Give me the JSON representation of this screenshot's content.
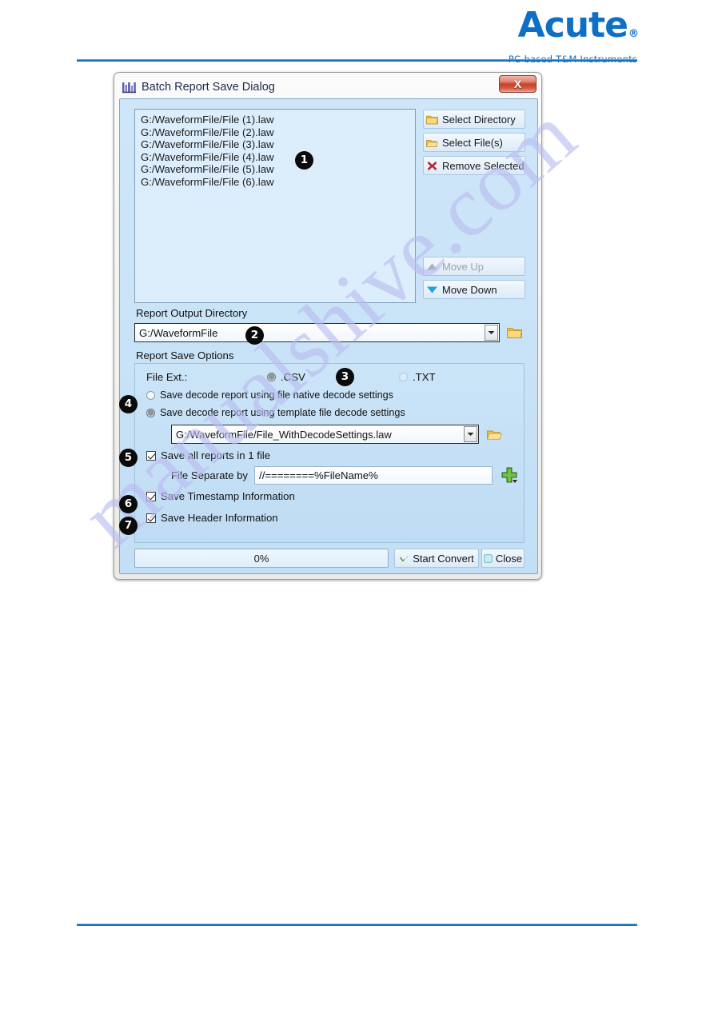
{
  "header": {
    "logo_name": "Acute",
    "logo_registered": "®",
    "logo_tagline": "PC-based T&M Instruments",
    "brand_color": "#0F6FC5"
  },
  "watermark": {
    "text": "manualshive.com"
  },
  "dialog": {
    "title": "Batch Report Save Dialog",
    "title_icon": "waveform-icon",
    "close_label": "X",
    "file_list": {
      "items": [
        "G:/WaveformFile/File (1).law",
        "G:/WaveformFile/File (2).law",
        "G:/WaveformFile/File (3).law",
        "G:/WaveformFile/File (4).law",
        "G:/WaveformFile/File (5).law",
        "G:/WaveformFile/File (6).law"
      ]
    },
    "side_buttons": {
      "select_directory": "Select Directory",
      "select_files": "Select File(s)",
      "remove_selected": "Remove Selected",
      "move_up": "Move Up",
      "move_down": "Move Down"
    },
    "output_directory": {
      "label": "Report Output Directory",
      "value": "G:/WaveformFile",
      "browse_icon": "folder-open-icon"
    },
    "save_options": {
      "label": "Report Save Options",
      "file_ext_label": "File Ext.:",
      "file_ext_options": [
        {
          "label": ".CSV",
          "selected": true
        },
        {
          "label": ".TXT",
          "selected": false
        }
      ],
      "decode_mode_options": [
        {
          "label": "Save decode report using file native decode settings",
          "selected": false
        },
        {
          "label": "Save decode report using template file decode settings",
          "selected": true
        }
      ],
      "template_file": {
        "value": "G:/WaveformFile/File_WithDecodeSettings.law",
        "browse_icon": "folder-open-icon"
      },
      "save_all_in_one": {
        "label": "Save all reports in 1 file",
        "checked": true
      },
      "file_separate_by": {
        "label": "File Separate by",
        "value": "//========%FileName%",
        "add_icon": "green-plus-icon"
      },
      "save_timestamp": {
        "label": "Save Timestamp Information",
        "checked": true
      },
      "save_header": {
        "label": "Save Header Information",
        "checked": true
      }
    },
    "footer": {
      "progress_text": "0%",
      "progress_percent": 0,
      "start_convert": "Start Convert",
      "close": "Close"
    }
  },
  "callouts": [
    {
      "number": "❶",
      "digit": "1"
    },
    {
      "number": "❷",
      "digit": "2"
    },
    {
      "number": "❸",
      "digit": "3"
    },
    {
      "number": "❹",
      "digit": "4"
    },
    {
      "number": "❺",
      "digit": "5"
    },
    {
      "number": "❻",
      "digit": "6"
    },
    {
      "number": "❼",
      "digit": "7"
    }
  ]
}
